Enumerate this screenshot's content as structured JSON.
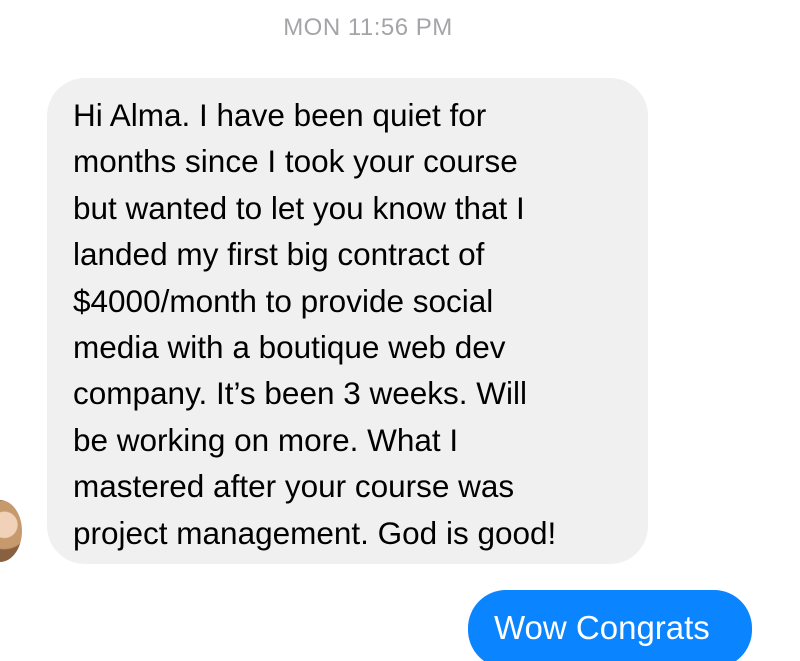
{
  "timestamp": "MON 11:56 PM",
  "incoming_message": {
    "lines": [
      "Hi Alma. I have been quiet for",
      "months since I took your course",
      "but wanted to let you know that I",
      "landed my first big contract of",
      "$4000/month to provide social",
      "media with a boutique web dev",
      "company. It’s been 3 weeks. Will",
      "be working on more. What I",
      "mastered after your course was",
      "project management. God is good!"
    ]
  },
  "outgoing_message": {
    "text": "Wow Congrats"
  },
  "colors": {
    "incoming_bubble": "#f0f0f0",
    "outgoing_bubble": "#0a84ff",
    "timestamp_text": "#a5a5a9"
  },
  "icons": {
    "sender_avatar": "avatar"
  }
}
